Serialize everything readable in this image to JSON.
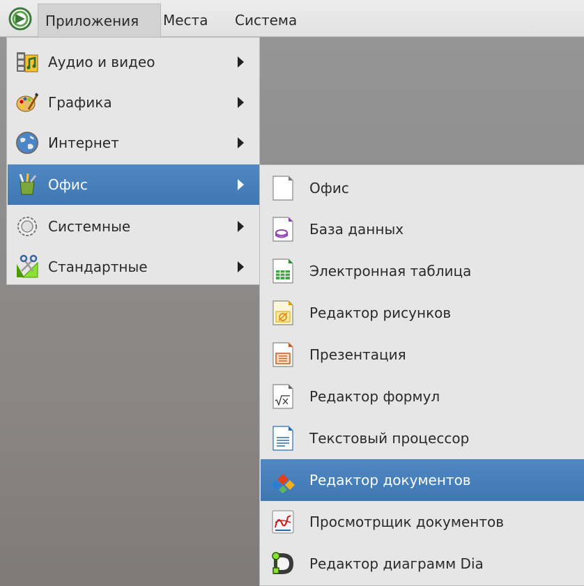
{
  "panel": {
    "apps_label": "Приложения",
    "places_label": "Места",
    "system_label": "Система"
  },
  "main_menu": {
    "items": [
      {
        "label": "Аудио и видео",
        "icon": "audio-video-icon"
      },
      {
        "label": "Графика",
        "icon": "graphics-icon"
      },
      {
        "label": "Интернет",
        "icon": "internet-globe-icon"
      },
      {
        "label": "Офис",
        "icon": "office-icon",
        "active": true
      },
      {
        "label": "Системные",
        "icon": "system-gear-icon"
      },
      {
        "label": "Стандартные",
        "icon": "accessories-icon"
      }
    ]
  },
  "office_submenu": {
    "items": [
      {
        "label": "Офис",
        "icon": "blank-document-icon"
      },
      {
        "label": "База данных",
        "icon": "database-icon"
      },
      {
        "label": "Электронная таблица",
        "icon": "spreadsheet-icon"
      },
      {
        "label": "Редактор рисунков",
        "icon": "drawing-icon"
      },
      {
        "label": "Презентация",
        "icon": "presentation-icon"
      },
      {
        "label": "Редактор формул",
        "icon": "formula-icon"
      },
      {
        "label": "Текстовый процессор",
        "icon": "text-document-icon"
      },
      {
        "label": "Редактор документов",
        "icon": "document-editor-icon",
        "active": true
      },
      {
        "label": "Просмотрщик документов",
        "icon": "document-viewer-icon"
      },
      {
        "label": "Редактор диаграмм Dia",
        "icon": "dia-icon"
      }
    ]
  },
  "colors": {
    "highlight": "#4380bd",
    "menu_bg": "#e6e6e6",
    "desktop_bg": "#8e8e8e"
  }
}
